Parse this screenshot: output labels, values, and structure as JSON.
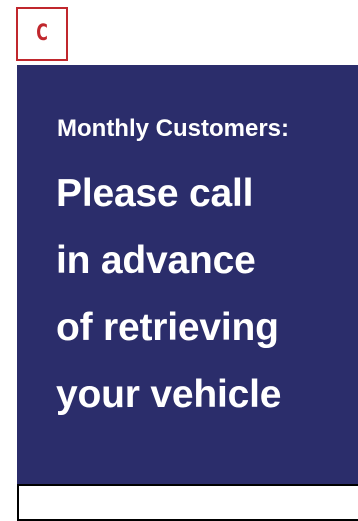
{
  "badge": {
    "letter": "C",
    "color": "#c0272d"
  },
  "sign": {
    "background_color": "#2b2d6b",
    "text_color": "#ffffff",
    "subtitle": "Monthly Customers:",
    "message_lines": [
      "Please call",
      "in advance",
      "of retrieving",
      "your vehicle"
    ]
  }
}
